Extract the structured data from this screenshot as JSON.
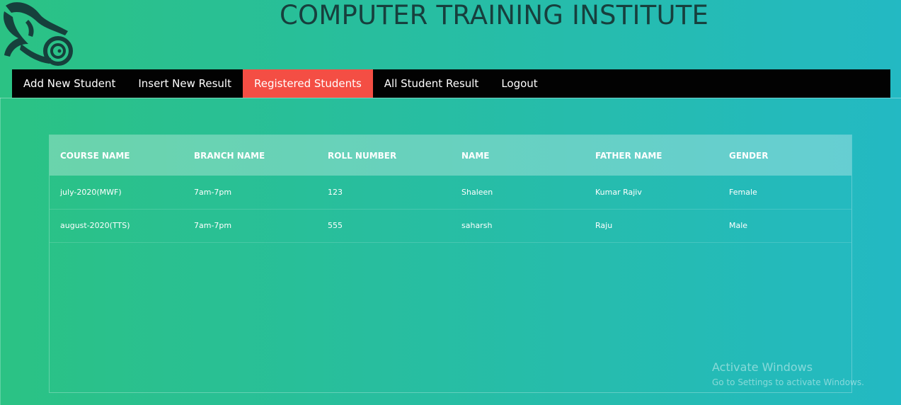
{
  "header": {
    "title": "COMPUTER TRAINING INSTITUTE",
    "logo_icon": "scroll-swirl-logo"
  },
  "navbar": {
    "items": [
      {
        "label": "Add New Student",
        "active": false
      },
      {
        "label": "Insert New Result",
        "active": false
      },
      {
        "label": "Registered Students",
        "active": true
      },
      {
        "label": "All Student Result",
        "active": false
      },
      {
        "label": "Logout",
        "active": false
      }
    ]
  },
  "table": {
    "columns": [
      "COURSE NAME",
      "BRANCH NAME",
      "ROLL NUMBER",
      "NAME",
      "FATHER NAME",
      "GENDER"
    ],
    "rows": [
      [
        "july-2020(MWF)",
        "7am-7pm",
        "123",
        "Shaleen",
        "Kumar Rajiv",
        "Female"
      ],
      [
        "august-2020(TTS)",
        "7am-7pm",
        "555",
        "saharsh",
        "Raju",
        "Male"
      ]
    ]
  },
  "watermark": {
    "title": "Activate Windows",
    "subtitle": "Go to Settings to activate Windows."
  },
  "colors": {
    "gradient_start": "#2bc284",
    "gradient_end": "#23b9c3",
    "navbar_bg": "#020202",
    "nav_active": "#f44e44",
    "title_color": "#173f3d"
  }
}
